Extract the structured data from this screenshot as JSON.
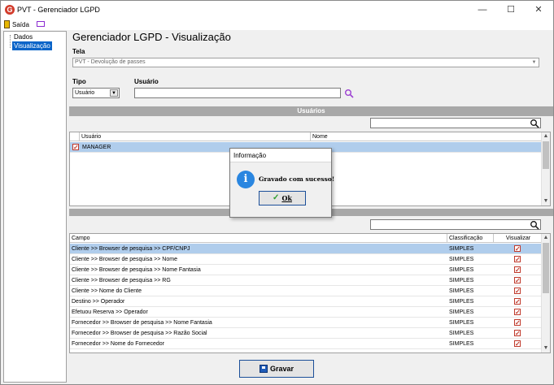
{
  "window": {
    "title": "PVT - Gerenciador LGPD",
    "icon_letter": "G",
    "minimize": "—",
    "maximize": "☐",
    "close": "✕"
  },
  "menu": {
    "exit_label": "Saída"
  },
  "tree": {
    "items": [
      {
        "label": "Dados"
      },
      {
        "label": "Visualização"
      }
    ]
  },
  "main": {
    "title": "Gerenciador LGPD - Visualização",
    "tela_label": "Tela",
    "tela_value": "PVT - Devolução de passes",
    "tipo_label": "Tipo",
    "tipo_value": "Usuário",
    "usuario_label": "Usuário"
  },
  "users": {
    "header": "Usuários",
    "columns": [
      "Usuário",
      "Nome"
    ],
    "rows": [
      {
        "usuario": "MANAGER",
        "nome": "",
        "checked": true
      }
    ]
  },
  "fields": {
    "columns": [
      "Campo",
      "Classificação",
      "Visualizar"
    ],
    "rows": [
      {
        "campo": "Cliente >> Browser de pesquisa >> CPF/CNPJ",
        "classificacao": "SIMPLES",
        "visualizar": true
      },
      {
        "campo": "Cliente >> Browser de pesquisa >> Nome",
        "classificacao": "SIMPLES",
        "visualizar": true
      },
      {
        "campo": "Cliente >> Browser de pesquisa >> Nome Fantasia",
        "classificacao": "SIMPLES",
        "visualizar": true
      },
      {
        "campo": "Cliente >> Browser de pesquisa >> RG",
        "classificacao": "SIMPLES",
        "visualizar": true
      },
      {
        "campo": "Cliente >> Nome do Cliente",
        "classificacao": "SIMPLES",
        "visualizar": true
      },
      {
        "campo": "Destino >> Operador",
        "classificacao": "SIMPLES",
        "visualizar": true
      },
      {
        "campo": "Efetuou Reserva >> Operador",
        "classificacao": "SIMPLES",
        "visualizar": true
      },
      {
        "campo": "Fornecedor >> Browser de pesquisa >> Nome Fantasia",
        "classificacao": "SIMPLES",
        "visualizar": true
      },
      {
        "campo": "Fornecedor >> Browser de pesquisa >> Razão Social",
        "classificacao": "SIMPLES",
        "visualizar": true
      },
      {
        "campo": "Fornecedor >> Nome do Fornecedor",
        "classificacao": "SIMPLES",
        "visualizar": true
      }
    ]
  },
  "footer": {
    "save_label": "Gravar"
  },
  "dialog": {
    "title": "Informação",
    "icon_letter": "i",
    "message": "Gravado com sucesso!",
    "ok_label": "Ok"
  },
  "colors": {
    "selection": "#0a64c8",
    "row_highlight": "#b0cdec",
    "section_header": "#a8a8a8",
    "button_border": "#1b4f99",
    "info_icon": "#2a86e0"
  }
}
